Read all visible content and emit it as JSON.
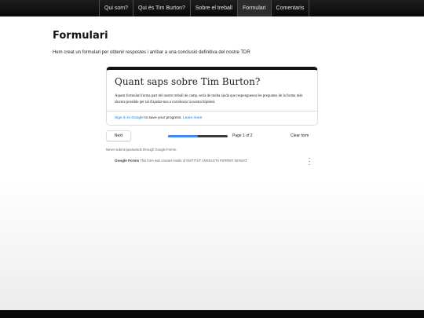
{
  "nav": {
    "items": [
      {
        "label": "Qui som?"
      },
      {
        "label": "Qui és Tim Burton?"
      },
      {
        "label": "Sobre el treball"
      },
      {
        "label": "Formulari"
      },
      {
        "label": "Comentaris"
      }
    ],
    "active_index": 3
  },
  "page": {
    "title": "Formulari",
    "intro": "Hem creat un formulari per obtenir respostes i arribar a una conclusió definitiva del nostre TDR"
  },
  "form": {
    "title": "Quant saps sobre Tim Burton?",
    "description": "Aquest formulari forma part del nostre treball de camp, seria de molta ajuda que responguessu les preguntes de la forma més sincera possible per tal d'ajudar-nos a corroborar la nostra hipòtesi.",
    "signin_link": "Sign in to Google",
    "signin_rest": " to save your progress. ",
    "learn_more": "Learn more",
    "next_label": "Next",
    "progress": 0.5,
    "page_counter": "Page 1 of 2",
    "clear_label": "Clear form",
    "password_warning": "Never submit passwords through Google Forms.",
    "footer_brand": "Google Forms",
    "footer_text": " This form was created inside of INSTITUT ANGELETA FERRER SENSAT"
  },
  "colors": {
    "accent": "#4285f4",
    "link": "#1a73e8",
    "nav_bg": "#111111"
  },
  "icons": {
    "more": "kebab-menu-icon"
  }
}
